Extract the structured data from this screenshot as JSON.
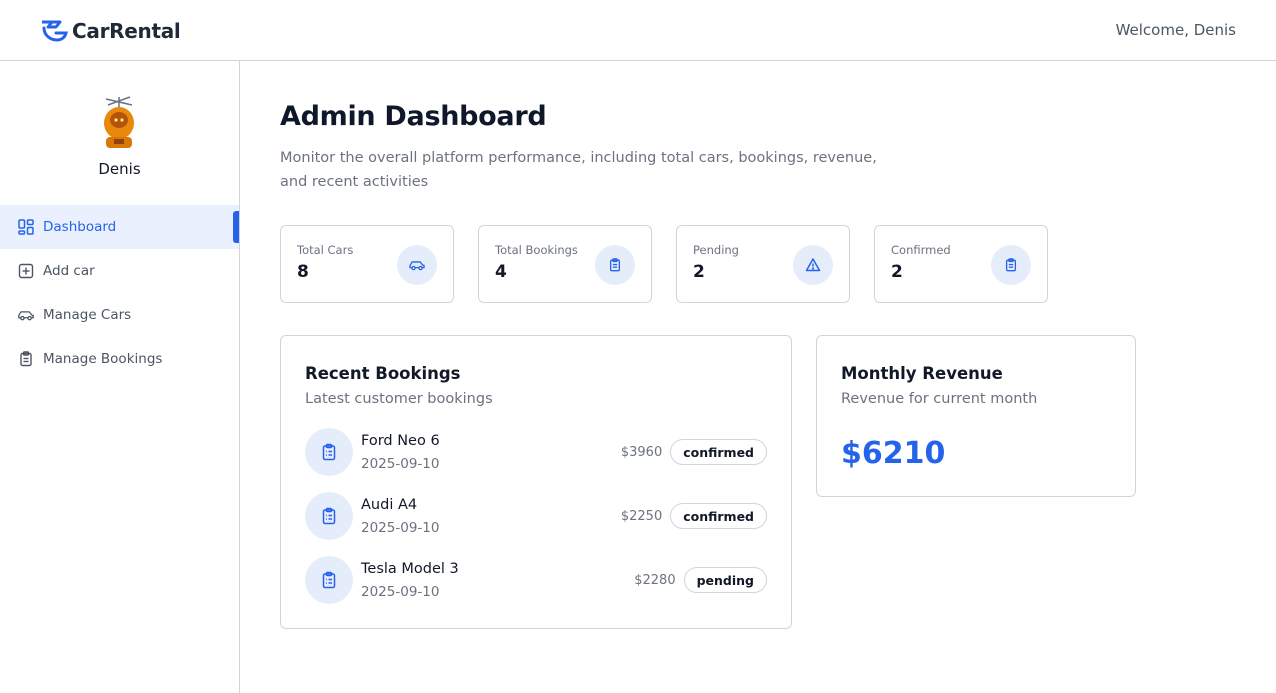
{
  "header": {
    "brand": "CarRental",
    "welcome": "Welcome, Denis"
  },
  "sidebar": {
    "username": "Denis",
    "items": [
      {
        "label": "Dashboard",
        "icon": "dashboard-icon",
        "active": true
      },
      {
        "label": "Add car",
        "icon": "add-square-icon",
        "active": false
      },
      {
        "label": "Manage Cars",
        "icon": "car-icon",
        "active": false
      },
      {
        "label": "Manage Bookings",
        "icon": "clipboard-icon",
        "active": false
      }
    ]
  },
  "main": {
    "title": "Admin Dashboard",
    "subtitle": "Monitor the overall platform performance, including total cars, bookings, revenue, and recent activities",
    "stats": [
      {
        "label": "Total Cars",
        "value": "8",
        "icon": "car-icon"
      },
      {
        "label": "Total Bookings",
        "value": "4",
        "icon": "clipboard-icon"
      },
      {
        "label": "Pending",
        "value": "2",
        "icon": "warning-icon"
      },
      {
        "label": "Confirmed",
        "value": "2",
        "icon": "clipboard-icon"
      }
    ],
    "recent": {
      "title": "Recent Bookings",
      "subtitle": "Latest customer bookings",
      "bookings": [
        {
          "car": "Ford Neo 6",
          "date": "2025-09-10",
          "price": "$3960",
          "status": "confirmed"
        },
        {
          "car": "Audi A4",
          "date": "2025-09-10",
          "price": "$2250",
          "status": "confirmed"
        },
        {
          "car": "Tesla Model 3",
          "date": "2025-09-10",
          "price": "$2280",
          "status": "pending"
        }
      ]
    },
    "revenue": {
      "title": "Monthly Revenue",
      "subtitle": "Revenue for current month",
      "value": "$6210"
    }
  },
  "colors": {
    "accent": "#2563eb",
    "accent_soft": "#e5edfb",
    "border": "#d1d5db",
    "muted_text": "#6b7280"
  }
}
